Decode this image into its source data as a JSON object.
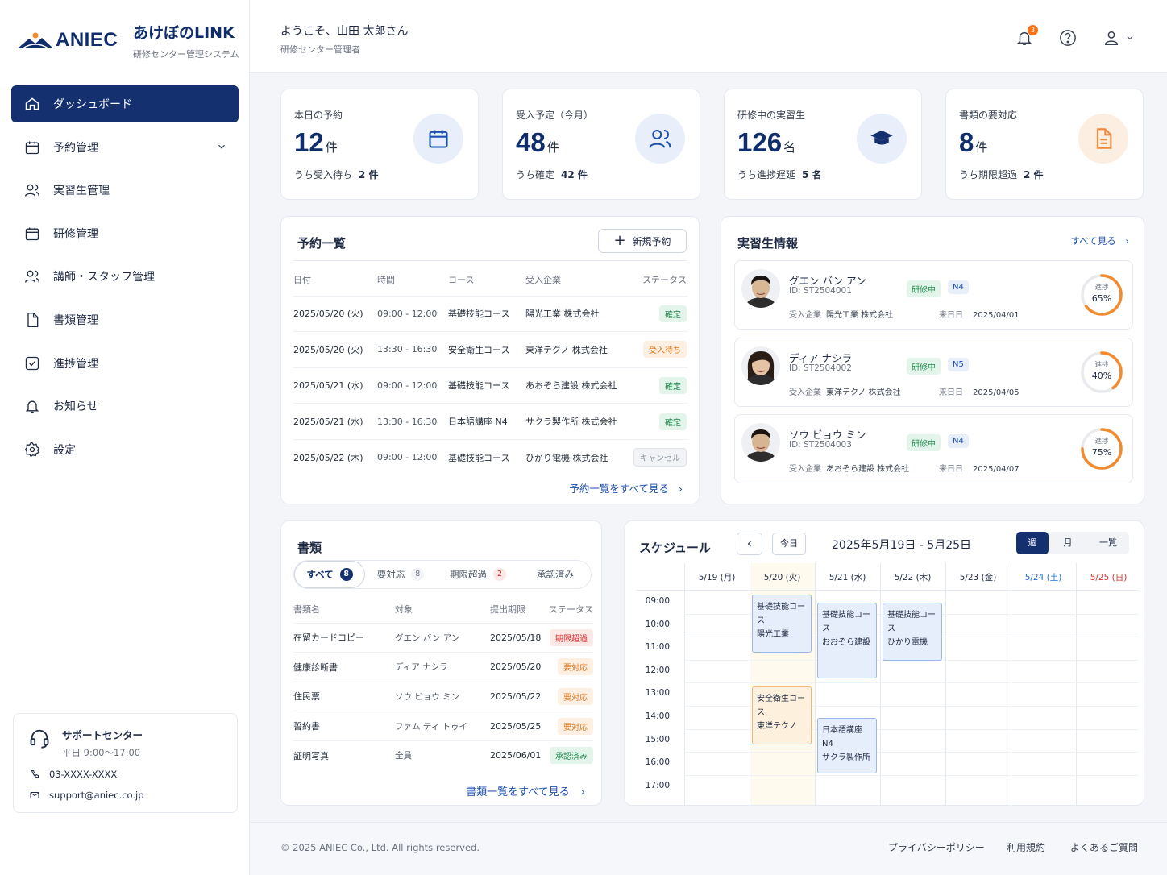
{
  "brand": {
    "logo_text": "ANIEC",
    "name": "あけぼのLINK",
    "subtitle": "研修センター管理システム"
  },
  "nav": [
    {
      "label": "ダッシュボード",
      "icon": "home-icon"
    },
    {
      "label": "予約管理",
      "icon": "calendar-icon"
    },
    {
      "label": "実習生管理",
      "icon": "users-icon"
    },
    {
      "label": "研修管理",
      "icon": "calendar-icon"
    },
    {
      "label": "講師・スタッフ管理",
      "icon": "users-icon"
    },
    {
      "label": "書類管理",
      "icon": "document-icon"
    },
    {
      "label": "進捗管理",
      "icon": "check-square-icon"
    },
    {
      "label": "お知らせ",
      "icon": "bell-icon"
    },
    {
      "label": "設定",
      "icon": "gear-icon"
    }
  ],
  "support": {
    "title": "サポートセンター",
    "hours": "平日 9:00〜17:00",
    "phone": "03-XXXX-XXXX",
    "email": "support@aniec.co.jp"
  },
  "header": {
    "welcome": "ようこそ、山田 太郎さん",
    "role": "研修センター管理者",
    "notification_count": "3"
  },
  "stats": [
    {
      "label": "本日の予約",
      "value": "12",
      "unit": "件",
      "sub_label": "うち受入待ち",
      "sub_value": "2 件",
      "icon": "calendar-icon",
      "color": "#1d4fb0",
      "bg": "#e8effb"
    },
    {
      "label": "受入予定（今月）",
      "value": "48",
      "unit": "件",
      "sub_label": "うち確定",
      "sub_value": "42 件",
      "icon": "users-icon",
      "color": "#1d4fb0",
      "bg": "#e8effb"
    },
    {
      "label": "研修中の実習生",
      "value": "126",
      "unit": "名",
      "sub_label": "うち進捗遅延",
      "sub_value": "5 名",
      "icon": "graduation-cap-icon",
      "color": "#14306e",
      "bg": "#e8effb"
    },
    {
      "label": "書類の要対応",
      "value": "8",
      "unit": "件",
      "sub_label": "うち期限超過",
      "sub_value": "2 件",
      "icon": "document-icon",
      "color": "#f08a3a",
      "bg": "#fdeee2"
    }
  ],
  "reservations": {
    "title": "予約一覧",
    "new_button": "新規予約",
    "headers": [
      "日付",
      "時間",
      "コース",
      "受入企業",
      "ステータス"
    ],
    "rows": [
      {
        "date": "2025/05/20 (火)",
        "time": "09:00 - 12:00",
        "course": "基礎技能コース",
        "company": "陽光工業 株式会社",
        "status": "確定",
        "tone": "green"
      },
      {
        "date": "2025/05/20 (火)",
        "time": "13:30 - 16:30",
        "course": "安全衛生コース",
        "company": "東洋テクノ 株式会社",
        "status": "受入待ち",
        "tone": "orange"
      },
      {
        "date": "2025/05/21 (水)",
        "time": "09:00 - 12:00",
        "course": "基礎技能コース",
        "company": "あおぞら建設 株式会社",
        "status": "確定",
        "tone": "green"
      },
      {
        "date": "2025/05/21 (水)",
        "time": "13:30 - 16:30",
        "course": "日本語講座 N4",
        "company": "サクラ製作所 株式会社",
        "status": "確定",
        "tone": "green"
      },
      {
        "date": "2025/05/22 (木)",
        "time": "09:00 - 12:00",
        "course": "基礎技能コース",
        "company": "ひかり電機 株式会社",
        "status": "キャンセル",
        "tone": "gray"
      }
    ],
    "view_all": "予約一覧をすべて見る"
  },
  "trainees": {
    "title": "実習生情報",
    "view_all": "すべて見る",
    "company_label": "受入企業",
    "arrival_label": "来日日",
    "progress_label": "進捗",
    "items": [
      {
        "name": "グエン バン アン",
        "id": "ID: ST2504001",
        "status": "研修中",
        "level": "N4",
        "company": "陽光工業 株式会社",
        "arrival": "2025/04/01",
        "progress": 65,
        "progress_text": "65%"
      },
      {
        "name": "ディア ナシラ",
        "id": "ID: ST2504002",
        "status": "研修中",
        "level": "N5",
        "company": "東洋テクノ 株式会社",
        "arrival": "2025/04/05",
        "progress": 40,
        "progress_text": "40%"
      },
      {
        "name": "ソウ ビョウ ミン",
        "id": "ID: ST2504003",
        "status": "研修中",
        "level": "N4",
        "company": "あおぞら建設 株式会社",
        "arrival": "2025/04/07",
        "progress": 75,
        "progress_text": "75%"
      }
    ]
  },
  "documents": {
    "title": "書類",
    "tabs": [
      {
        "label": "すべて",
        "count": "8"
      },
      {
        "label": "要対応",
        "count": "8"
      },
      {
        "label": "期限超過",
        "count": "2"
      },
      {
        "label": "承認済み",
        "count": ""
      }
    ],
    "headers": [
      "書類名",
      "対象",
      "提出期限",
      "ステータス"
    ],
    "rows": [
      {
        "name": "在留カードコピー",
        "target": "グエン バン アン",
        "due": "2025/05/18",
        "status": "期限超過",
        "tone": "red"
      },
      {
        "name": "健康診断書",
        "target": "ディア ナシラ",
        "due": "2025/05/20",
        "status": "要対応",
        "tone": "orange"
      },
      {
        "name": "住民票",
        "target": "ソウ ビョウ ミン",
        "due": "2025/05/22",
        "status": "要対応",
        "tone": "orange"
      },
      {
        "name": "誓約書",
        "target": "ファム ティ トゥイ",
        "due": "2025/05/25",
        "status": "要対応",
        "tone": "orange"
      },
      {
        "name": "証明写真",
        "target": "全員",
        "due": "2025/06/01",
        "status": "承認済み",
        "tone": "green"
      }
    ],
    "view_all": "書類一覧をすべて見る"
  },
  "schedule": {
    "title": "スケジュール",
    "today_button": "今日",
    "range": "2025年5月19日 - 5月25日",
    "views": [
      "週",
      "月",
      "一覧"
    ],
    "days": [
      "5/19 (月)",
      "5/20 (火)",
      "5/21 (水)",
      "5/22 (木)",
      "5/23 (金)",
      "5/24 (土)",
      "5/25 (日)"
    ],
    "times": [
      "09:00",
      "10:00",
      "11:00",
      "12:00",
      "13:00",
      "14:00",
      "15:00",
      "16:00",
      "17:00"
    ],
    "events": [
      {
        "day": 1,
        "start": 9.0,
        "end": 11.5,
        "line1": "基礎技能コース",
        "line2": "陽光工業",
        "tone": "blue"
      },
      {
        "day": 2,
        "start": 9.0,
        "end": 12.3,
        "line1": "基礎技能コース",
        "line2": "おおぞら建設",
        "tone": "blue"
      },
      {
        "day": 3,
        "start": 9.0,
        "end": 11.5,
        "line1": "基礎技能コース",
        "line2": "ひかり電機",
        "tone": "blue"
      },
      {
        "day": 1,
        "start": 13.0,
        "end": 15.5,
        "line1": "安全衛生コース",
        "line2": "東洋テクノ",
        "tone": "orange"
      },
      {
        "day": 2,
        "start": 14.0,
        "end": 16.4,
        "line1": "日本語講座 N4",
        "line2": "サクラ製作所",
        "tone": "blue"
      }
    ]
  },
  "footer": {
    "copyright": "© 2025 ANIEC Co., Ltd. All rights reserved.",
    "links": [
      "プライバシーポリシー",
      "利用規約",
      "よくあるご質問"
    ]
  }
}
